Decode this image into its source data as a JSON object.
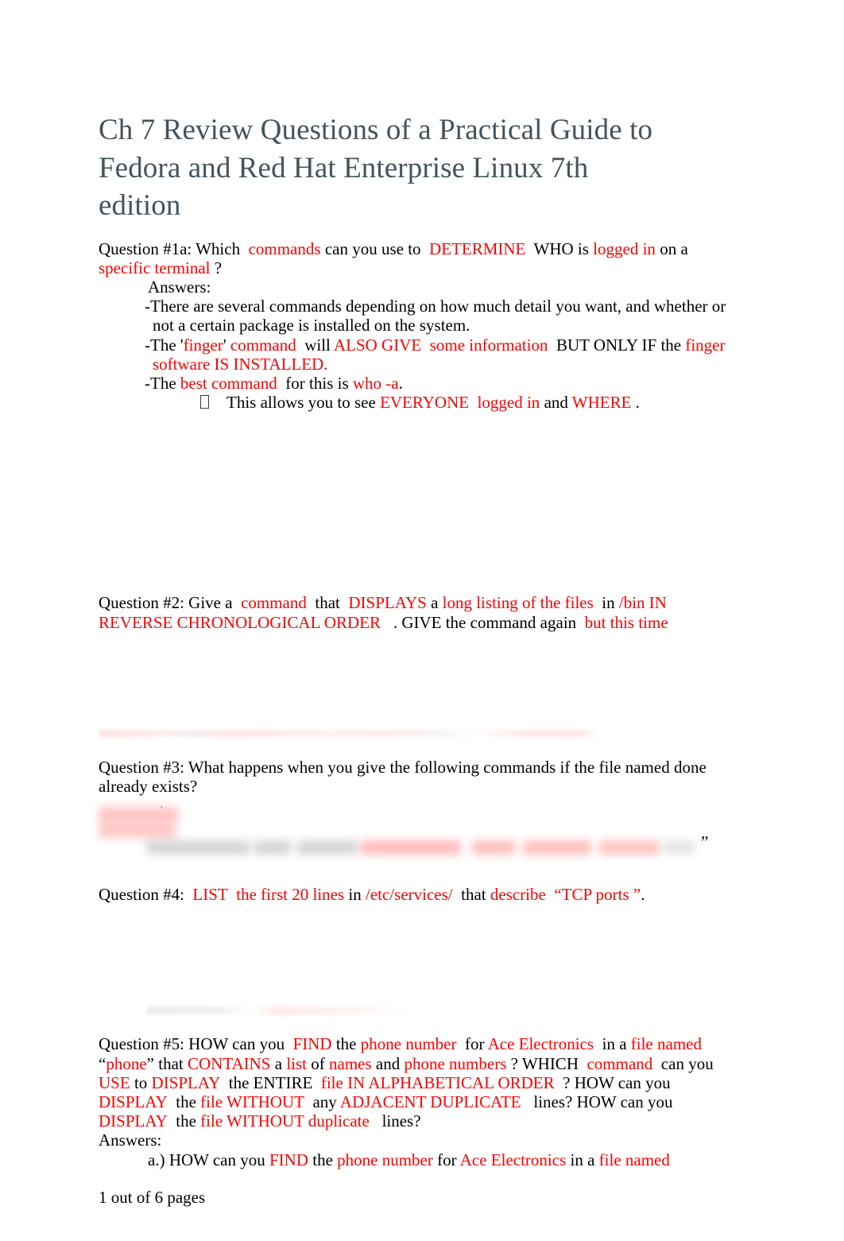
{
  "document": {
    "title": "Ch 7 Review Questions of a Practical Guide to Fedora and Red Hat Enterprise Linux 7th edition",
    "title_color": "#44535c",
    "accent_color": "#ff0000",
    "body_color": "#000000",
    "background": "#ffffff",
    "footer": "1 out of 6 pages"
  },
  "q1": {
    "prompt": {
      "p1": "Question #1a: Which",
      "r1": "commands",
      "p2": "can you use to",
      "r2": "DETERMINE",
      "p3": "WHO is",
      "r3": "logged in",
      "p4": "on a",
      "r4": "specific terminal",
      "p5": "?"
    },
    "answers_label": "Answers:",
    "a1": "-There are several commands depending on how much detail you want, and whether or not a certain package is installed on the system.",
    "a2": {
      "p1": "-The '",
      "r1": "finger",
      "p2": "'",
      "r2": "command",
      "p3": "will",
      "r3": "ALSO GIVE",
      "r4": "some information",
      "p4": "BUT ONLY IF the",
      "r5": "finger software IS INSTALLED."
    },
    "a3": {
      "p1": "-The",
      "r1": "best command",
      "p2": "for this is",
      "r2": "who -a",
      "p3": "."
    },
    "bullet": {
      "glyph": "missing-glyph-box",
      "p1": "This allows you to see",
      "r1": "EVERYONE",
      "r2": "logged in",
      "p2": "and",
      "r3": "WHERE",
      "p3": "."
    }
  },
  "q2": {
    "p1": "Question #2: Give a",
    "r1": "command",
    "p2": "that",
    "r2": "DISPLAYS",
    "p3": "a",
    "r3": "long listing of the files",
    "p4": "in",
    "r4": "/bin IN REVERSE CHRONOLOGICAL ORDER",
    "p5": ". GIVE the command again",
    "r5": "but this time"
  },
  "q3": {
    "text": "Question #3: What happens when you give the following commands if the file named done already exists?",
    "redacted_above": "blurred-illegible-line",
    "redacted_below": "blurred-illegible-block",
    "trailing_quote": "”"
  },
  "q4": {
    "p1": "Question #4:",
    "r1": "LIST",
    "r2": "the first 20 lines",
    "p2": "in",
    "r3": "/etc/services/",
    "p3": "that",
    "r4": "describe",
    "r5": "“TCP ports ”",
    "p4": "."
  },
  "q5": {
    "redacted_above": "blurred-illegible-line",
    "line1": {
      "p1": "Question #5:  HOW can you",
      "r1": "FIND",
      "p2": "the",
      "r2": "phone number",
      "p3": "for",
      "r3": "Ace Electronics",
      "p4": "in a",
      "r4": "file named"
    },
    "line2": {
      "q_open": "“",
      "r1": "phone",
      "q_close": "”",
      "p1": "that",
      "r2": "CONTAINS",
      "p2": "a",
      "r3": "list",
      "p3": "of",
      "r4": "names",
      "p4": "and",
      "r5": "phone numbers",
      "p5": "? WHICH",
      "r6": "command",
      "p6": "can you"
    },
    "line3": {
      "r1": "USE",
      "p1": "to",
      "r2": "DISPLAY",
      "p2": "the ENTIRE",
      "r3": "file IN ALPHABETICAL ORDER",
      "p3": "? HOW can you"
    },
    "line4": {
      "r1": "DISPLAY",
      "p1": "the",
      "r2": "file WITHOUT",
      "p2": "any",
      "r3": "ADJACENT DUPLICATE",
      "p3": "lines? HOW can you"
    },
    "line5": {
      "r1": "DISPLAY",
      "p1": "the",
      "r2": "file WITHOUT duplicate",
      "p2": "lines?"
    },
    "answers_label": "Answers:",
    "answer_a": {
      "p1": "a.) HOW can you",
      "r1": "FIND",
      "p2": "the",
      "r2": "phone number",
      "p3": "for",
      "r3": "Ace Electronics",
      "p4": "in a",
      "r4": "file named"
    }
  }
}
